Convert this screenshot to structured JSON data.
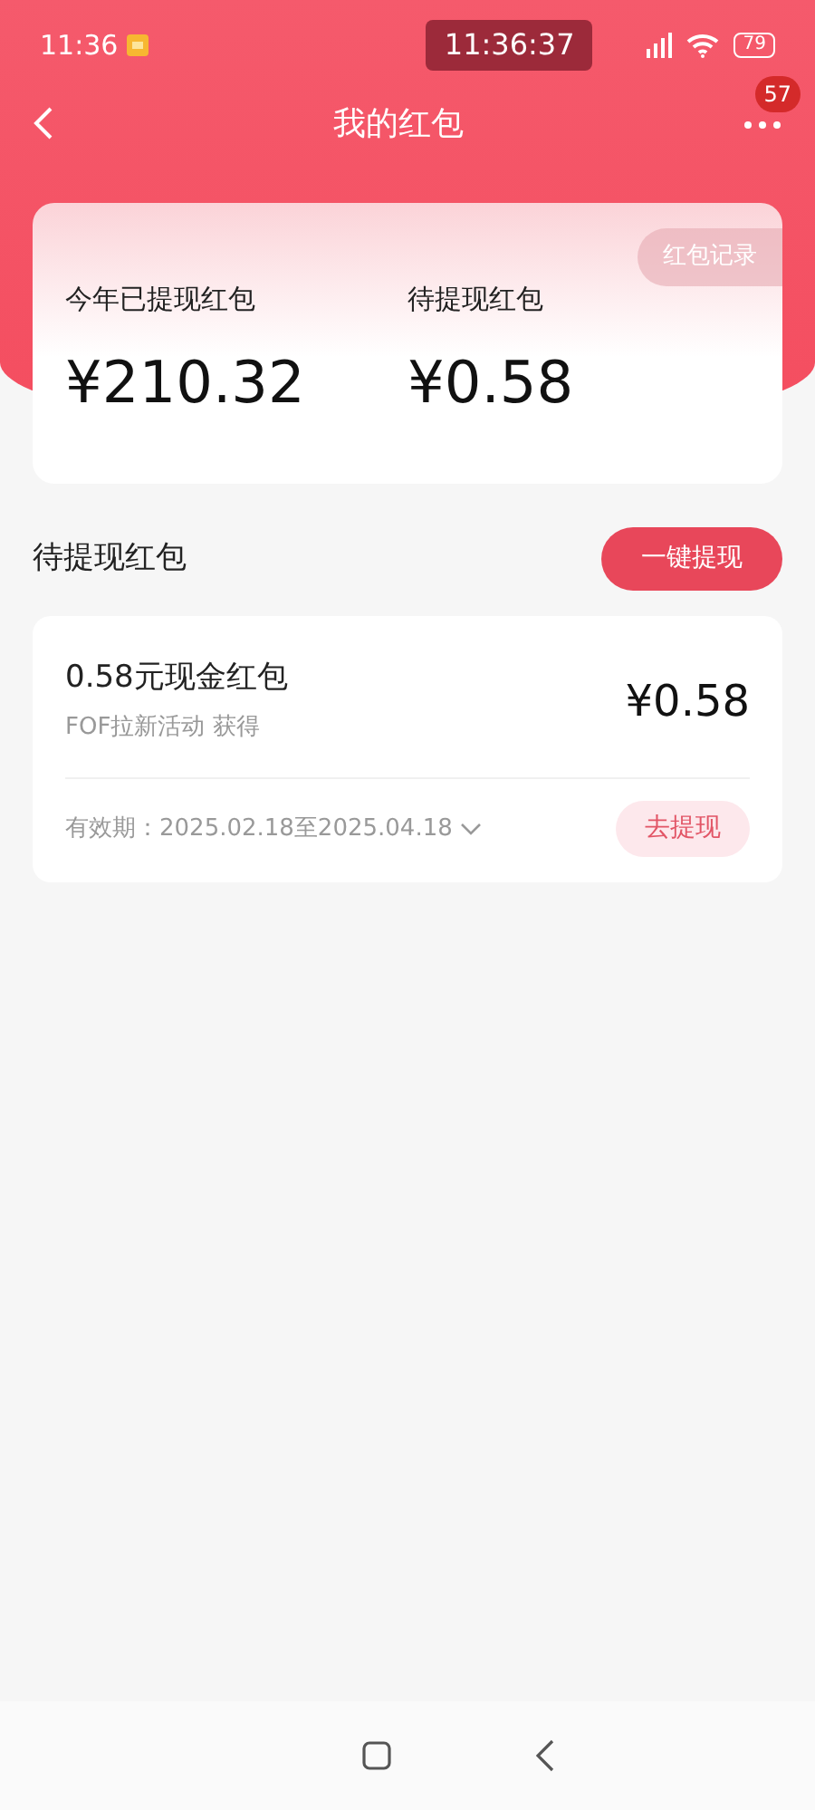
{
  "status_bar": {
    "time": "11:36",
    "clock": "11:36:37",
    "battery": "79"
  },
  "header": {
    "title": "我的红包",
    "badge": "57"
  },
  "summary": {
    "record_button": "红包记录",
    "stats": [
      {
        "label": "今年已提现红包",
        "value": "¥210.32"
      },
      {
        "label": "待提现红包",
        "value": "¥0.58"
      }
    ]
  },
  "pending": {
    "title": "待提现红包",
    "button": "一键提现",
    "items": [
      {
        "title": "0.58元现金红包",
        "source": "FOF拉新活动 获得",
        "amount": "¥0.58",
        "validity": "有效期：2025.02.18至2025.04.18",
        "button": "去提现"
      }
    ]
  }
}
